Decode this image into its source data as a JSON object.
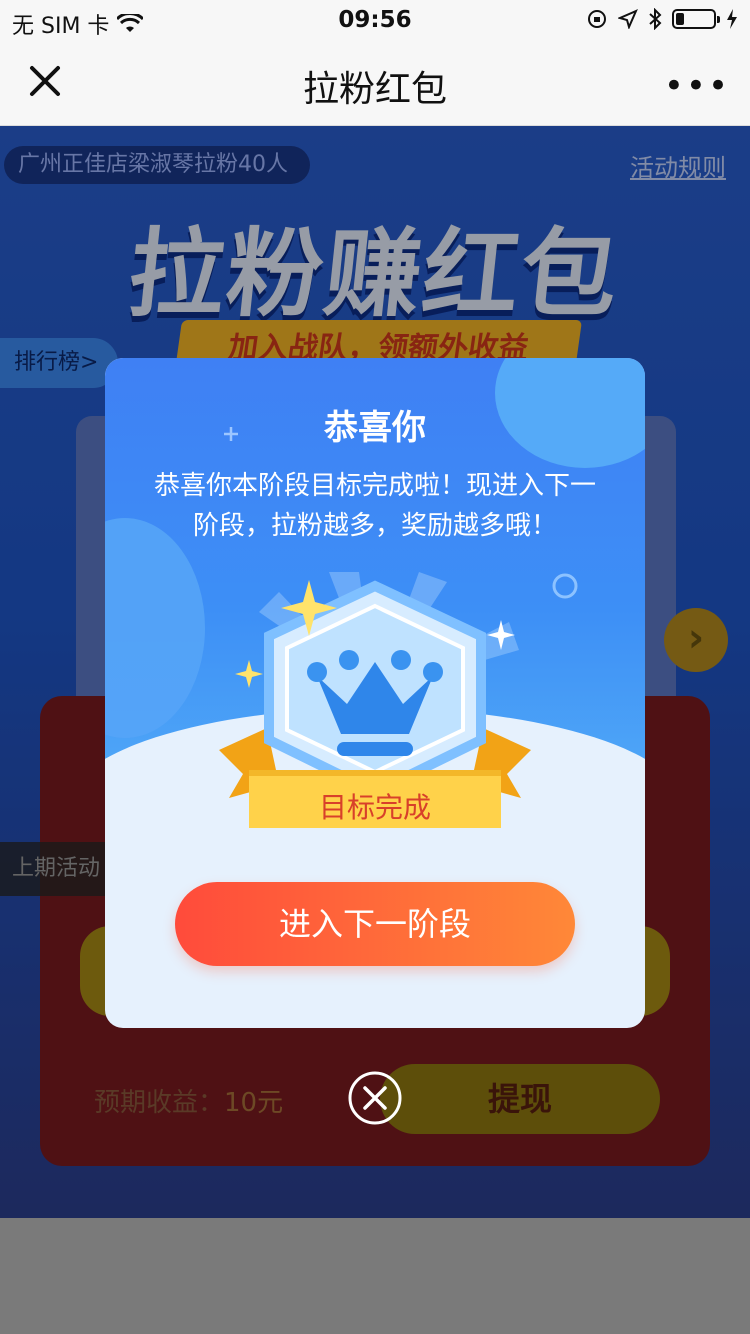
{
  "status_bar": {
    "carrier": "无 SIM 卡",
    "time": "09:56",
    "icons": [
      "wifi-icon",
      "orientation-lock-icon",
      "location-icon",
      "bluetooth-icon",
      "battery-icon",
      "charging-icon"
    ]
  },
  "nav": {
    "title": "拉粉红包",
    "close_icon": "close-icon",
    "more_label": "•••"
  },
  "background": {
    "store_notice": "广州正佳店梁淑琴拉粉40人",
    "rules_link": "活动规则",
    "big_title": "拉粉赚红包",
    "ribbon": "加入战队，领额外收益",
    "rank_tab": "排行榜>",
    "prev_tab": "上期活动",
    "expected_label": "预期收益：",
    "expected_amount": "10元",
    "withdraw_label": "提现",
    "arrow_icon": "›"
  },
  "modal": {
    "title": "恭喜你",
    "message": "恭喜你本阶段目标完成啦！现进入下一阶段，拉粉越多，奖励越多哦！",
    "badge_label": "目标完成",
    "badge_icon": "crown-icon",
    "next_button": "进入下一阶段",
    "close_icon": "close-circle-icon"
  },
  "colors": {
    "modal_blue": "#3f80f4",
    "button_start": "#ff4b3b",
    "button_end": "#ff8838",
    "badge_ribbon": "#f5b626"
  }
}
